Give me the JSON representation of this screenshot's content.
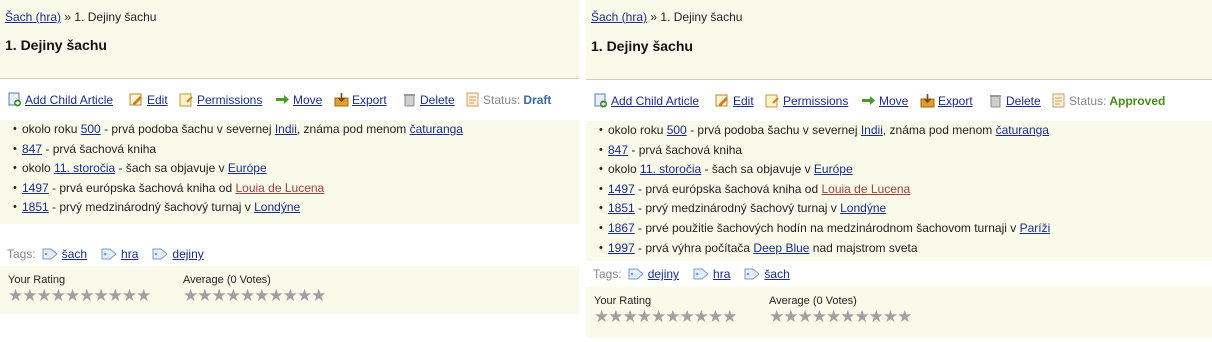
{
  "left": {
    "breadcrumb": {
      "link": "Šach (hra)",
      "sep": "»",
      "current": "1. Dejiny šachu"
    },
    "title": "1. Dejiny šachu",
    "toolbar": {
      "add_child": "Add Child Article",
      "edit": "Edit",
      "permissions": "Permissions",
      "move": "Move",
      "export": "Export",
      "delete": "Delete",
      "status_label": "Status:",
      "status_value": "Draft"
    },
    "events": [
      {
        "pre": "okolo roku ",
        "link": "500",
        "mid": " - prvá podoba šachu v severnej ",
        "link2": "Indii",
        "post": ", známa pod menom ",
        "link3": "čaturanga"
      },
      {
        "link": "847",
        "mid": " - prvá šachová kniha"
      },
      {
        "pre": "okolo ",
        "link": "11. storočia",
        "mid": " - šach sa objavuje v ",
        "link2": "Európe"
      },
      {
        "link": "1497",
        "mid": " - prvá európska šachová kniha od ",
        "link2": "Louia de Lucena"
      },
      {
        "link": "1851",
        "mid": " - prvý medzinárodný šachový turnaj v ",
        "link2": "Londýne"
      }
    ],
    "tags_label": "Tags:",
    "tags": [
      "šach",
      "hra",
      "dejiny"
    ],
    "your_rating": "Your Rating",
    "average": "Average (0 Votes)",
    "stars": "★★★★★★★★★★"
  },
  "right": {
    "breadcrumb": {
      "link": "Šach (hra)",
      "sep": "»",
      "current": "1. Dejiny šachu"
    },
    "title": "1. Dejiny šachu",
    "toolbar": {
      "add_child": "Add Child Article",
      "edit": "Edit",
      "permissions": "Permissions",
      "move": "Move",
      "export": "Export",
      "delete": "Delete",
      "status_label": "Status:",
      "status_value": "Approved"
    },
    "events": [
      {
        "pre": "okolo roku ",
        "link": "500",
        "mid": " - prvá podoba šachu v severnej ",
        "link2": "Indii",
        "post": ", známa pod menom ",
        "link3": "čaturanga"
      },
      {
        "link": "847",
        "mid": " - prvá šachová kniha"
      },
      {
        "pre": "okolo ",
        "link": "11. storočia",
        "mid": " - šach sa objavuje v ",
        "link2": "Európe"
      },
      {
        "link": "1497",
        "mid": " - prvá európska šachová kniha od ",
        "link2": "Louia de Lucena"
      },
      {
        "link": "1851",
        "mid": " - prvý medzinárodný šachový turnaj v ",
        "link2": "Londýne"
      },
      {
        "link": "1867",
        "mid": " - prvé použitie šachových hodín na medzinárodnom šachovom turnaji v ",
        "link2": "Paríži"
      },
      {
        "link": "1997",
        "mid": " - prvá výhra počítača ",
        "link2": "Deep Blue",
        "post": " nad majstrom sveta"
      }
    ],
    "tags_label": "Tags:",
    "tags": [
      "dejiny",
      "hra",
      "šach"
    ],
    "your_rating": "Your Rating",
    "average": "Average (0 Votes)",
    "stars": "★★★★★★★★★★"
  },
  "colors": {
    "panel_bg": "#fafaeb",
    "link": "#1a2c8c",
    "status_draft": "#3b6aa0",
    "status_approved": "#4a8a1a",
    "visited_link": "#a0413b"
  }
}
